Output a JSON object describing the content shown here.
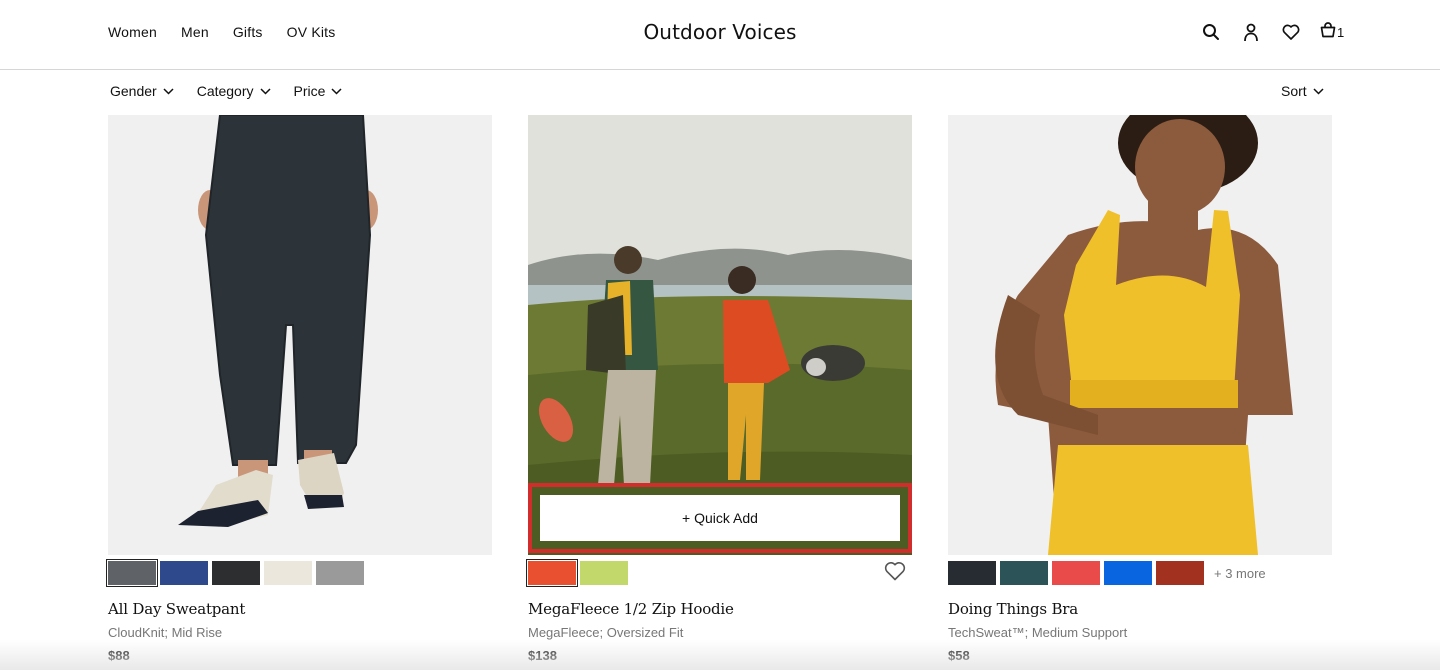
{
  "header": {
    "nav": [
      "Women",
      "Men",
      "Gifts",
      "OV Kits"
    ],
    "logo": "Outdoor Voices",
    "cart_count": "1"
  },
  "filters": {
    "items": [
      "Gender",
      "Category",
      "Price"
    ],
    "sort_label": "Sort"
  },
  "products": [
    {
      "name": "All Day Sweatpant",
      "desc": "CloudKnit; Mid Rise",
      "price": "$88",
      "swatches": [
        "#5f6266",
        "#2e4a8c",
        "#2c2e30",
        "#ebe7dd",
        "#9a9a9a"
      ],
      "more": ""
    },
    {
      "name": "MegaFleece 1/2 Zip Hoodie",
      "desc": "MegaFleece; Oversized Fit",
      "price": "$138",
      "swatches": [
        "#e8502f",
        "#c2d86a"
      ],
      "quick_add": "+ Quick Add",
      "more": ""
    },
    {
      "name": "Doing Things Bra",
      "desc": "TechSweat™; Medium Support",
      "price": "$58",
      "swatches": [
        "#262c31",
        "#2c5358",
        "#e94a4a",
        "#0a66e0",
        "#a3311f"
      ],
      "more": "+ 3 more"
    }
  ],
  "colors": {
    "highlight": "#d22d2d",
    "text_muted": "#777777"
  }
}
